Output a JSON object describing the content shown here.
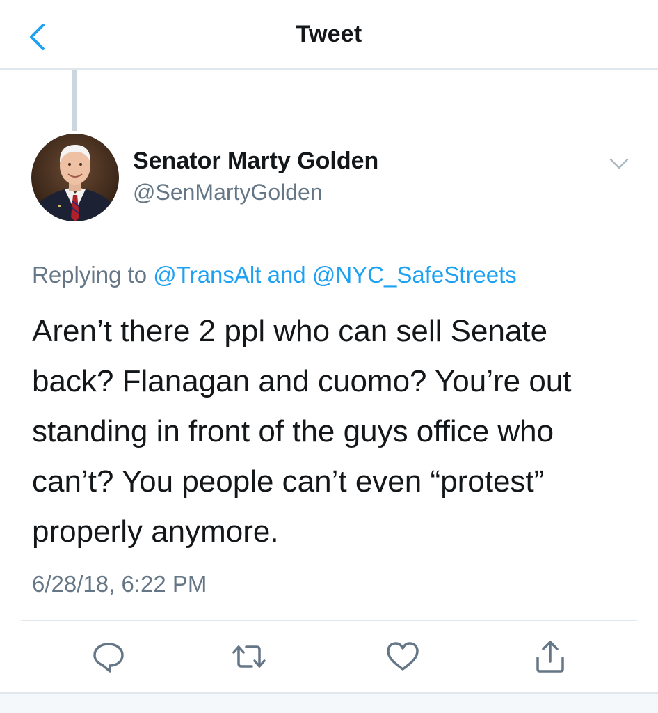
{
  "header": {
    "title": "Tweet",
    "back_icon": "chevron-left-icon",
    "accent_color": "#1da1f2"
  },
  "tweet": {
    "author": {
      "name": "Senator Marty Golden",
      "handle": "@SenMartyGolden"
    },
    "replying_to": {
      "prefix": "Replying to",
      "mention_1": "@TransAlt",
      "conjunction": "and",
      "mention_2": "@NYC_SafeStreets"
    },
    "text_lines": [
      "Aren’t there 2 ppl who can sell Senate",
      "back? Flanagan and cuomo? You’re out",
      "standing in front of the guys office who",
      "can’t? You people can’t even “protest”",
      "properly anymore."
    ],
    "timestamp": "6/28/18, 6:22 PM"
  },
  "actions": [
    {
      "name": "reply",
      "icon": "reply-icon"
    },
    {
      "name": "retweet",
      "icon": "retweet-icon"
    },
    {
      "name": "like",
      "icon": "heart-icon"
    },
    {
      "name": "share",
      "icon": "share-icon"
    }
  ],
  "colors": {
    "text_primary": "#14171a",
    "text_secondary": "#657786",
    "link": "#1da1f2",
    "divider": "#e1e8ed"
  }
}
